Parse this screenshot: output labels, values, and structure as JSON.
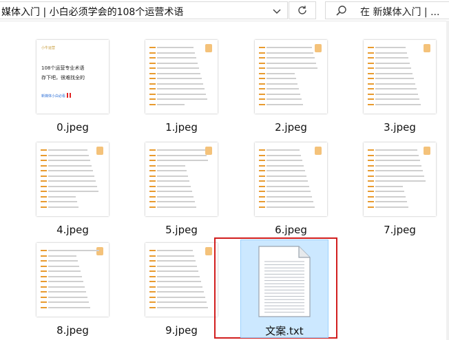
{
  "address_bar": {
    "path": "媒体入门 | 小白必须学会的108个运营术语",
    "dropdown_icon": "chevron-down-icon",
    "refresh_icon": "refresh-icon"
  },
  "search": {
    "placeholder": "在 新媒体入门 | ...",
    "icon": "search-icon"
  },
  "files": [
    {
      "name": "0.jpeg",
      "kind": "cover"
    },
    {
      "name": "1.jpeg",
      "kind": "list"
    },
    {
      "name": "2.jpeg",
      "kind": "list"
    },
    {
      "name": "3.jpeg",
      "kind": "list"
    },
    {
      "name": "4.jpeg",
      "kind": "list"
    },
    {
      "name": "5.jpeg",
      "kind": "list"
    },
    {
      "name": "6.jpeg",
      "kind": "list"
    },
    {
      "name": "7.jpeg",
      "kind": "list"
    },
    {
      "name": "8.jpeg",
      "kind": "list"
    },
    {
      "name": "9.jpeg",
      "kind": "list"
    },
    {
      "name": "文案.txt",
      "kind": "text",
      "selected": true
    }
  ],
  "cover": {
    "brand": "小牛运营",
    "title_line1": "108个运营专业术语",
    "title_line2": "存下吧，很难找全的",
    "footer": "新媒体小白必看"
  },
  "colors": {
    "selection_bg": "#cce8ff",
    "highlight_border": "#d11d1d",
    "accent_orange": "#e89a2e"
  }
}
